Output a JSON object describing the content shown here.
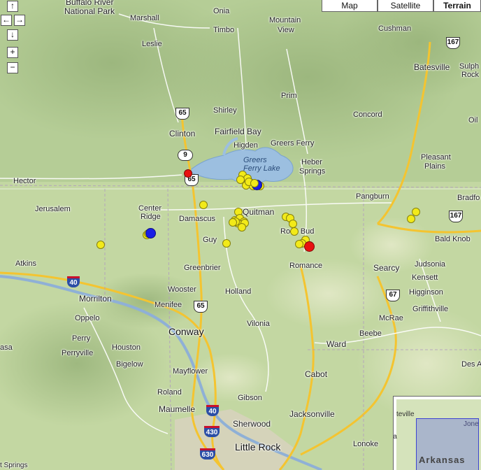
{
  "map_type_buttons": [
    "Map",
    "Satellite",
    "Terrain"
  ],
  "active_map_type": "Terrain",
  "controls": {
    "pan_up": "↑",
    "pan_left": "←",
    "pan_right": "→",
    "pan_down": "↓",
    "zoom_in": "+",
    "zoom_out": "−"
  },
  "lake_label": "Greers\nFerry Lake",
  "places": {
    "buffalo_river": "Buffalo River",
    "national_park": "National Park",
    "marshall": "Marshall",
    "leslie": "Leslie",
    "onia": "Onia",
    "timbo": "Timbo",
    "mountain": "Mountain",
    "view": "View",
    "cushman": "Cushman",
    "batesville": "Batesville",
    "sulph": "Sulph",
    "rock": "Rock",
    "prim": "Prim",
    "shirley": "Shirley",
    "concord": "Concord",
    "clinton": "Clinton",
    "fairfield_bay": "Fairfield Bay",
    "higden": "Higden",
    "greers_ferry": "Greers Ferry",
    "heber": "Heber",
    "springs": "Springs",
    "pleasant": "Pleasant",
    "plains": "Plains",
    "hector": "Hector",
    "oil": "Oil",
    "pangburn": "Pangburn",
    "bradfo": "Bradfo",
    "jerusalem": "Jerusalem",
    "center": "Center",
    "ridge": "Ridge",
    "damascus": "Damascus",
    "quitman": "Quitman",
    "rose_bud": "Rose Bud",
    "bald_knob": "Bald Knob",
    "guy": "Guy",
    "atkins": "Atkins",
    "greenbrier": "Greenbrier",
    "romance": "Romance",
    "searcy": "Searcy",
    "judsonia": "Judsonia",
    "kensett": "Kensett",
    "wooster": "Wooster",
    "holland": "Holland",
    "higginson": "Higginson",
    "morrilton": "Morrilton",
    "menifee": "Menifee",
    "griffithville": "Griffithville",
    "oppelo": "Oppelo",
    "vilonia": "Vilonia",
    "mcrae": "McRae",
    "conway": "Conway",
    "perry": "Perry",
    "asa": "asa",
    "ward": "Ward",
    "beebe": "Beebe",
    "des_a": "Des A",
    "perryville": "Perryville",
    "houston": "Houston",
    "bigelow": "Bigelow",
    "mayflower": "Mayflower",
    "cabot": "Cabot",
    "roland": "Roland",
    "gibson": "Gibson",
    "maumelle": "Maumelle",
    "jacksonville": "Jacksonville",
    "sherwood": "Sherwood",
    "lonoke": "Lonoke",
    "little_rock": "Little Rock",
    "springs_bottom": "t Springs"
  },
  "highway_shields": {
    "us167_north": "167",
    "us65_north": "65",
    "ar9": "9",
    "us65_clinton": "65",
    "us167_east": "167",
    "i40_west": "40",
    "us65_south": "65",
    "us67": "67",
    "i40_south": "40",
    "i430": "430",
    "i630": "630"
  },
  "overview": {
    "state_label": "Arkansas",
    "town1": "teville",
    "town2": "Jone",
    "town3": "Ca"
  },
  "markers": [
    {
      "color": "#e81010",
      "size": 12
    },
    {
      "color": "#f2ea19",
      "size": 12
    },
    {
      "color": "#f2ea19",
      "size": 12
    },
    {
      "color": "#f2ea19",
      "size": 12
    },
    {
      "color": "#f2ea19",
      "size": 12
    },
    {
      "color": "#f2ea19",
      "size": 12
    },
    {
      "color": "#f2ea19",
      "size": 12
    },
    {
      "color": "#f2ea19",
      "size": 12
    },
    {
      "color": "#1a1ee6",
      "size": 15
    },
    {
      "color": "#f2ea19",
      "size": 12
    },
    {
      "color": "#f2ea19",
      "size": 12
    },
    {
      "color": "#f2ea19",
      "size": 12
    },
    {
      "color": "#f2ea19",
      "size": 12
    },
    {
      "color": "#f2ea19",
      "size": 12
    },
    {
      "color": "#f2ea19",
      "size": 12
    },
    {
      "color": "#f2ea19",
      "size": 12
    },
    {
      "color": "#f2ea19",
      "size": 12
    },
    {
      "color": "#f2ea19",
      "size": 12
    },
    {
      "color": "#f2ea19",
      "size": 12
    },
    {
      "color": "#f2ea19",
      "size": 12
    },
    {
      "color": "#f2ea19",
      "size": 12
    },
    {
      "color": "#f2ea19",
      "size": 12
    },
    {
      "color": "#f2ea19",
      "size": 12
    },
    {
      "color": "#f2ea19",
      "size": 12
    },
    {
      "color": "#f2ea19",
      "size": 12
    },
    {
      "color": "#f2ea19",
      "size": 12
    },
    {
      "color": "#f2ea19",
      "size": 12
    },
    {
      "color": "#f2ea19",
      "size": 12
    },
    {
      "color": "#f2ea19",
      "size": 12
    },
    {
      "color": "#f2ea19",
      "size": 12
    },
    {
      "color": "#e81010",
      "size": 15
    },
    {
      "color": "#f2ea19",
      "size": 12
    },
    {
      "color": "#f2ea19",
      "size": 12
    },
    {
      "color": "#f2ea19",
      "size": 12
    },
    {
      "color": "#1a1ee6",
      "size": 15
    },
    {
      "color": "#f2ea19",
      "size": 12
    },
    {
      "color": "#f2ea19",
      "size": 12
    },
    {
      "color": "#f2ea19",
      "size": 12
    },
    {
      "color": "#f2ea19",
      "size": 12
    }
  ]
}
